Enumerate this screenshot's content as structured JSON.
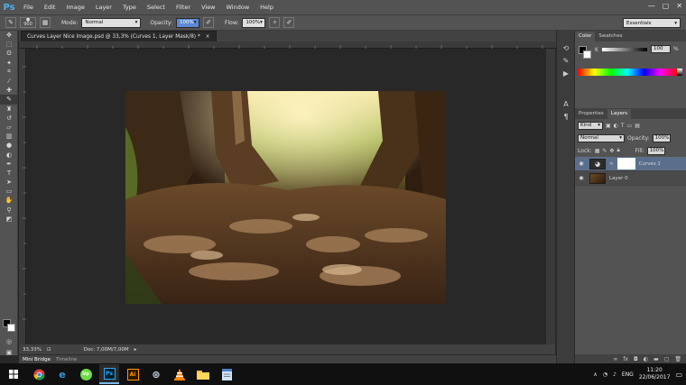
{
  "app": {
    "logo": "Ps"
  },
  "menu": [
    "File",
    "Edit",
    "Image",
    "Layer",
    "Type",
    "Select",
    "Filter",
    "View",
    "Window",
    "Help"
  ],
  "window_controls": [
    "—",
    "▢",
    "✕"
  ],
  "options_bar": {
    "brush_size": "900",
    "mode_label": "Mode:",
    "mode_value": "Normal",
    "opacity_label": "Opacity:",
    "opacity_value": "100%",
    "flow_label": "Flow:",
    "flow_value": "100%",
    "workspace": "Essentials"
  },
  "document": {
    "tab_title": "Curves Layer Nice Image.psd @ 33,3% (Curves 1, Layer Mask/8) *",
    "close": "×"
  },
  "status": {
    "zoom": "33,33%",
    "doc": "Doc: 7,00M/7,00M"
  },
  "bottom_tabs": [
    "Mini Bridge",
    "Timeline"
  ],
  "color_panel": {
    "tabs": [
      "Color",
      "Swatches"
    ],
    "channel_label": "K",
    "value": "100",
    "unit": "%"
  },
  "layers_panel": {
    "tabs": [
      "Properties",
      "Layers"
    ],
    "kind": "Kind",
    "blend_mode": "Normal",
    "opacity_label": "Opacity:",
    "opacity_value": "100%",
    "lock_label": "Lock:",
    "fill_label": "Fill:",
    "fill_value": "100%",
    "layers": [
      {
        "name": "Curves 1",
        "selected": true
      },
      {
        "name": "Layer 0",
        "selected": false
      }
    ]
  },
  "taskbar": {
    "apps": [
      "chrome-icon",
      "edge-icon",
      "upwork-icon",
      "photoshop-icon",
      "illustrator-icon",
      "steam-icon",
      "vlc-icon",
      "explorer-icon",
      "notepad-icon"
    ],
    "ps_label": "Ps",
    "ai_label": "Ai",
    "upwork_label": "Up",
    "language": "ENG",
    "time": "11:20",
    "date": "22/06/2017"
  },
  "colors": {
    "accent": "#4fb0e8",
    "selected_layer": "#5b6f8c"
  }
}
